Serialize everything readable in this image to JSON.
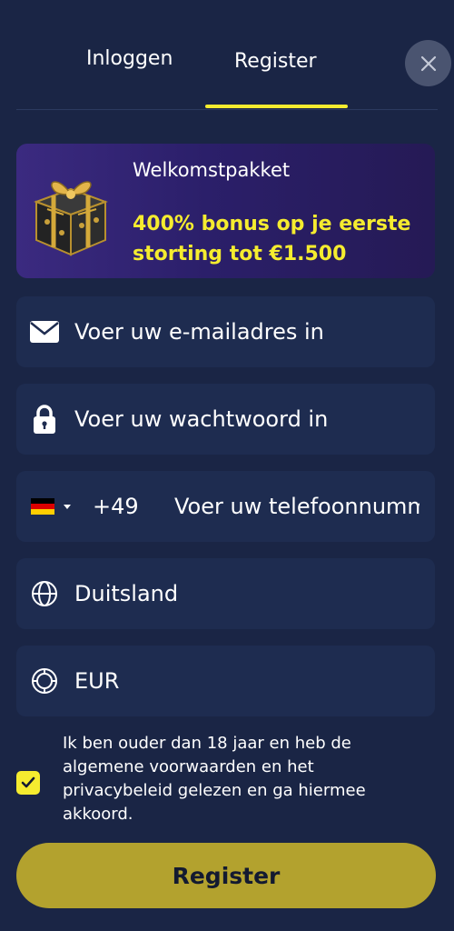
{
  "tabs": {
    "login_label": "Inloggen",
    "register_label": "Register"
  },
  "promo": {
    "title": "Welkomstpakket",
    "bonus_line1": "400% bonus op je eerste",
    "bonus_line2": "storting tot €1.500"
  },
  "form": {
    "email_placeholder": "Voer uw e-mailadres in",
    "password_placeholder": "Voer uw wachtwoord in",
    "phone_dial_code": "+49",
    "phone_placeholder": "Voer uw telefoonnummer in",
    "country_value": "Duitsland",
    "currency_value": "EUR"
  },
  "terms": {
    "text": "Ik ben ouder dan 18 jaar en heb de algemene voorwaarden en het privacybeleid gelezen en ga hiermee akkoord.",
    "checked": true
  },
  "submit_label": "Register",
  "icons": {
    "close": "close-icon",
    "gift": "gift-box-icon",
    "email": "envelope-icon",
    "password": "lock-icon",
    "flag": "germany-flag-icon",
    "country": "globe-icon",
    "currency": "currency-icon",
    "check": "check-icon"
  },
  "colors": {
    "background": "#1a2545",
    "field_background": "#1e2c50",
    "accent_yellow": "#f5ec2f",
    "button_background": "#b3a22e",
    "promo_gradient_start": "#3b2a80"
  }
}
